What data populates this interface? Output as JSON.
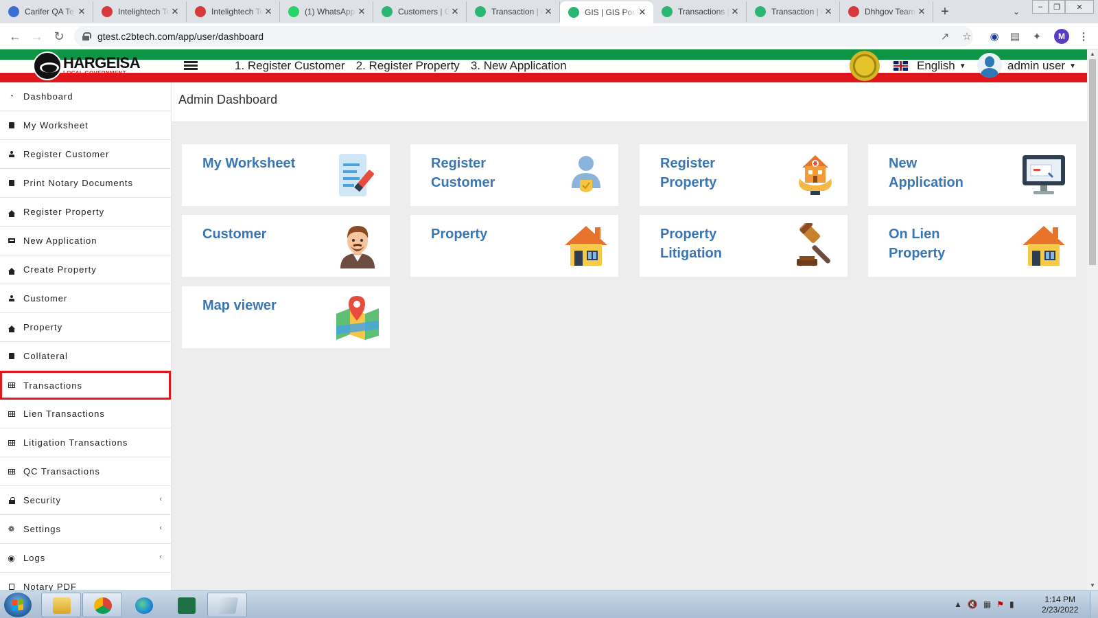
{
  "browser": {
    "tabs": [
      {
        "title": "Carifer QA Te",
        "favicon_color": "#3b6fd4"
      },
      {
        "title": "Intelightech Te",
        "favicon_color": "#d63a3a"
      },
      {
        "title": "Intelightech Te",
        "favicon_color": "#d63a3a"
      },
      {
        "title": "(1) WhatsApp",
        "favicon_color": "#25d366"
      },
      {
        "title": "Customers | G",
        "favicon_color": "#2bb673"
      },
      {
        "title": "Transaction | G",
        "favicon_color": "#2bb673"
      },
      {
        "title": "GIS | GIS Port",
        "favicon_color": "#2bb673",
        "active": true
      },
      {
        "title": "Transactions |",
        "favicon_color": "#2bb673"
      },
      {
        "title": "Transaction | G",
        "favicon_color": "#2bb673"
      },
      {
        "title": "Dhhgov Team",
        "favicon_color": "#d63a3a"
      }
    ],
    "url": "gtest.c2btech.com/app/user/dashboard",
    "profile_initial": "M"
  },
  "header": {
    "logo_name": "HARGEISA",
    "logo_sub": "LOCAL GOVERNMENT",
    "quick_links": [
      "1. Register Customer",
      "2. Register Property",
      "3. New Application"
    ],
    "language": "English",
    "user": "admin user",
    "colors": {
      "green": "#0d9444",
      "red": "#e0161d"
    }
  },
  "sidebar": {
    "items": [
      {
        "label": "Dashboard",
        "icon": "dashboard-icon"
      },
      {
        "label": "My Worksheet",
        "icon": "book-icon"
      },
      {
        "label": "Register Customer",
        "icon": "user-icon"
      },
      {
        "label": "Print Notary Documents",
        "icon": "print-icon"
      },
      {
        "label": "Register Property",
        "icon": "home-icon"
      },
      {
        "label": "New Application",
        "icon": "monitor-icon"
      },
      {
        "label": "Create Property",
        "icon": "home-icon"
      },
      {
        "label": "Customer",
        "icon": "user-icon"
      },
      {
        "label": "Property",
        "icon": "home-icon"
      },
      {
        "label": "Collateral",
        "icon": "book-icon"
      },
      {
        "label": "Transactions",
        "icon": "table-icon",
        "active": true
      },
      {
        "label": "Lien Transactions",
        "icon": "table-icon"
      },
      {
        "label": "Litigation Transactions",
        "icon": "table-icon"
      },
      {
        "label": "QC Transactions",
        "icon": "table-icon"
      },
      {
        "label": "Security",
        "icon": "lock-icon",
        "expandable": true
      },
      {
        "label": "Settings",
        "icon": "gear-icon",
        "expandable": true
      },
      {
        "label": "Logs",
        "icon": "eye-icon",
        "expandable": true
      },
      {
        "label": "Notary PDF",
        "icon": "file-icon"
      }
    ]
  },
  "main": {
    "page_title": "Admin Dashboard",
    "cards": [
      {
        "title": "My Worksheet",
        "icon": "worksheet-icon"
      },
      {
        "title": "Register\nCustomer",
        "icon": "customer-badge-icon"
      },
      {
        "title": "Register\nProperty",
        "icon": "property-hands-icon"
      },
      {
        "title": "New\nApplication",
        "icon": "application-monitor-icon"
      },
      {
        "title": "Customer",
        "icon": "man-avatar-icon"
      },
      {
        "title": "Property",
        "icon": "house-icon"
      },
      {
        "title": "Property\nLitigation",
        "icon": "gavel-icon"
      },
      {
        "title": "On Lien\nProperty",
        "icon": "house-icon"
      },
      {
        "title": "Map viewer",
        "icon": "map-pin-icon"
      }
    ]
  },
  "taskbar": {
    "time": "1:14 PM",
    "date": "2/23/2022"
  }
}
